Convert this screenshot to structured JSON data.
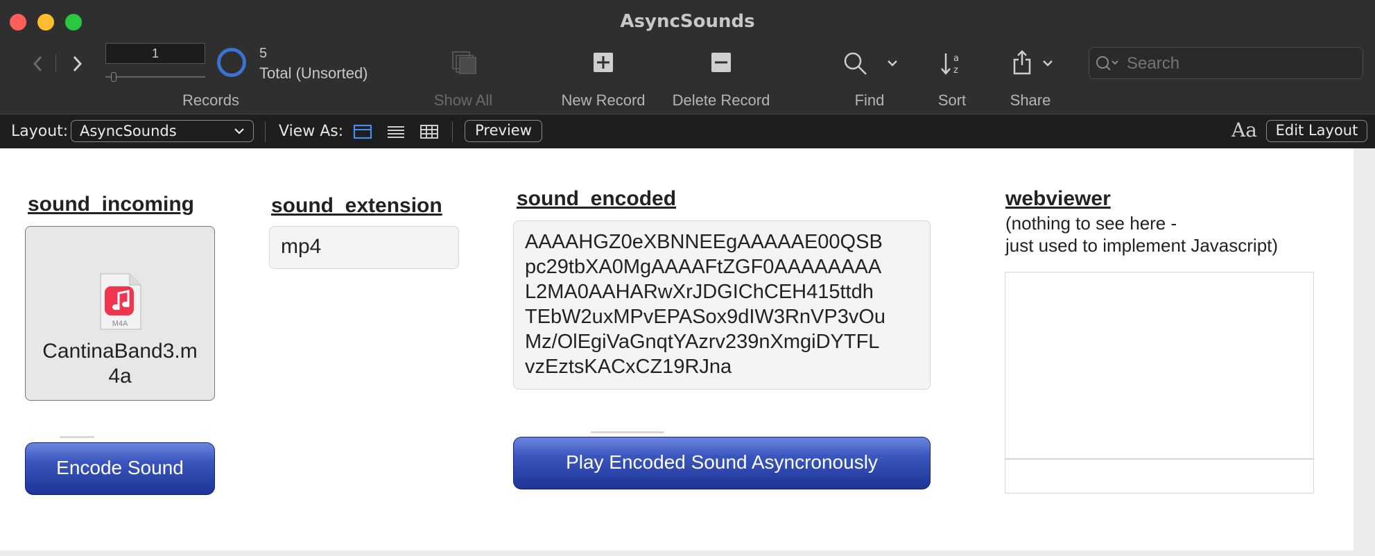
{
  "window": {
    "title": "AsyncSounds",
    "traffic_lights": {
      "close": "#ff5f57",
      "minimize": "#febc2e",
      "zoom": "#28c840"
    }
  },
  "toolbar": {
    "record_number": "1",
    "records_total": "5",
    "records_status": "Total (Unsorted)",
    "records_label": "Records",
    "show_all_label": "Show All",
    "new_record_label": "New Record",
    "delete_record_label": "Delete Record",
    "find_label": "Find",
    "sort_label": "Sort",
    "share_label": "Share",
    "search_placeholder": "Search"
  },
  "layout_bar": {
    "layout_label": "Layout:",
    "layout_value": "AsyncSounds",
    "view_as_label": "View As:",
    "preview_label": "Preview",
    "edit_layout_label": "Edit Layout",
    "font_size_glyph": "Aa"
  },
  "form": {
    "sound_incoming": {
      "label": "sound_incoming",
      "file_name": "CantinaBand3.m4a",
      "file_type": "M4A"
    },
    "sound_extension": {
      "label": "sound_extension",
      "value": "mp4"
    },
    "sound_encoded": {
      "label": "sound_encoded",
      "lines": [
        "AAAAHGZ0eXBNNEEgAAAAAE00QSB",
        "pc29tbXA0MgAAAAFtZGF0AAAAAAAA",
        "L2MA0AAHARwXrJDGIChCEH415ttdh",
        "TEbW2uxMPvEPASox9dIW3RnVP3vOu",
        "Mz/OlEgiVaGnqtYAzrv239nXmgiDYTFL",
        "vzEztsKACxCZ19RJna"
      ]
    },
    "webviewer": {
      "label": "webviewer",
      "note_line1": "(nothing to see here -",
      "note_line2": "just used to implement Javascript)"
    },
    "encode_button": "Encode Sound",
    "play_button": "Play Encoded Sound Asyncronously"
  },
  "colors": {
    "accent_blue": "#3b57be",
    "toolbar_bg": "#2f2f2f",
    "music_icon_red": "#f0364f"
  }
}
